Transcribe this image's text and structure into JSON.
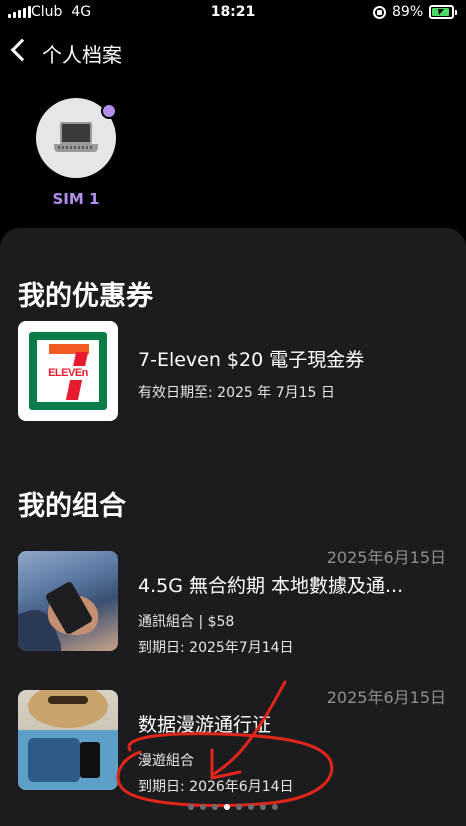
{
  "status_bar": {
    "carrier": "Club",
    "network": "4G",
    "time": "18:21",
    "battery_percent": "89%",
    "battery_level": 0.89
  },
  "nav": {
    "back_icon": "chevron-left-icon",
    "title": "个人档案"
  },
  "profile": {
    "avatar_icon": "laptop-icon",
    "status_dot_color": "#b58ff0",
    "sim_label": "SIM 1"
  },
  "coupons": {
    "section_title": "我的优惠券",
    "items": [
      {
        "logo": "7-eleven-logo",
        "logo_text": "ELEVEn",
        "title": "7-Eleven $20 電子現金券",
        "validity": "有效日期至: 2025 年 7月15 日"
      }
    ]
  },
  "bundles": {
    "section_title": "我的组合",
    "items": [
      {
        "date": "2025年6月15日",
        "title": "4.5G 無合約期 本地數據及通...",
        "subtitle": "通訊組合 | $58",
        "expiry": "到期日: 2025年7月14日"
      },
      {
        "date": "2025年6月15日",
        "title": "数据漫游通行证",
        "subtitle": "漫遊組合",
        "expiry": "到期日: 2026年6月14日"
      }
    ]
  },
  "pager": {
    "count": 8,
    "active_index": 3
  },
  "colors": {
    "accent": "#b58ff0",
    "card_bg": "#1c1c1e",
    "annotation": "#e0261b"
  }
}
